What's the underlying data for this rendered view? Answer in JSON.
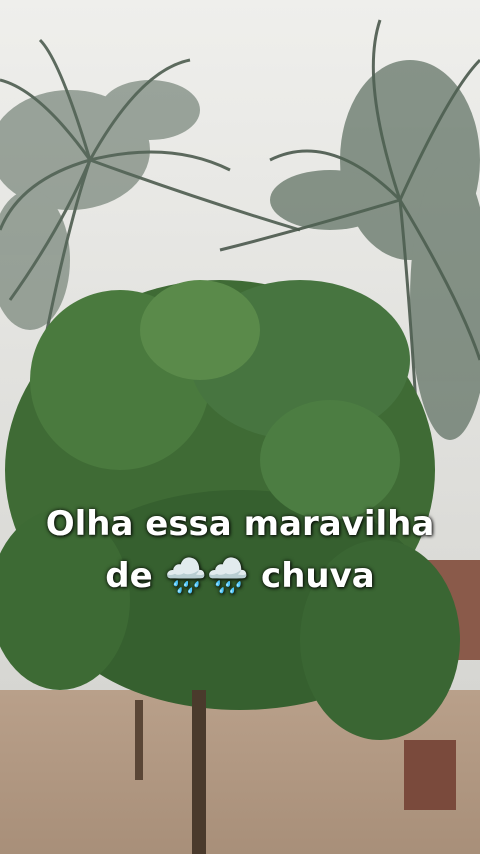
{
  "caption": {
    "line1": "Olha essa maravilha",
    "line2_prefix": "de",
    "emoji": "🌧️🌧️",
    "line2_suffix": "chuva"
  },
  "colors": {
    "sky": "#e4e4e0",
    "foliage": "#3f6b35",
    "ground": "#b59c86",
    "palm": "#5a6b5c",
    "caption_text": "#ffffff"
  },
  "scene_elements": [
    "cloudy-sky",
    "palm-trees",
    "leafy-tree",
    "dirt-ground",
    "brick-wall"
  ]
}
